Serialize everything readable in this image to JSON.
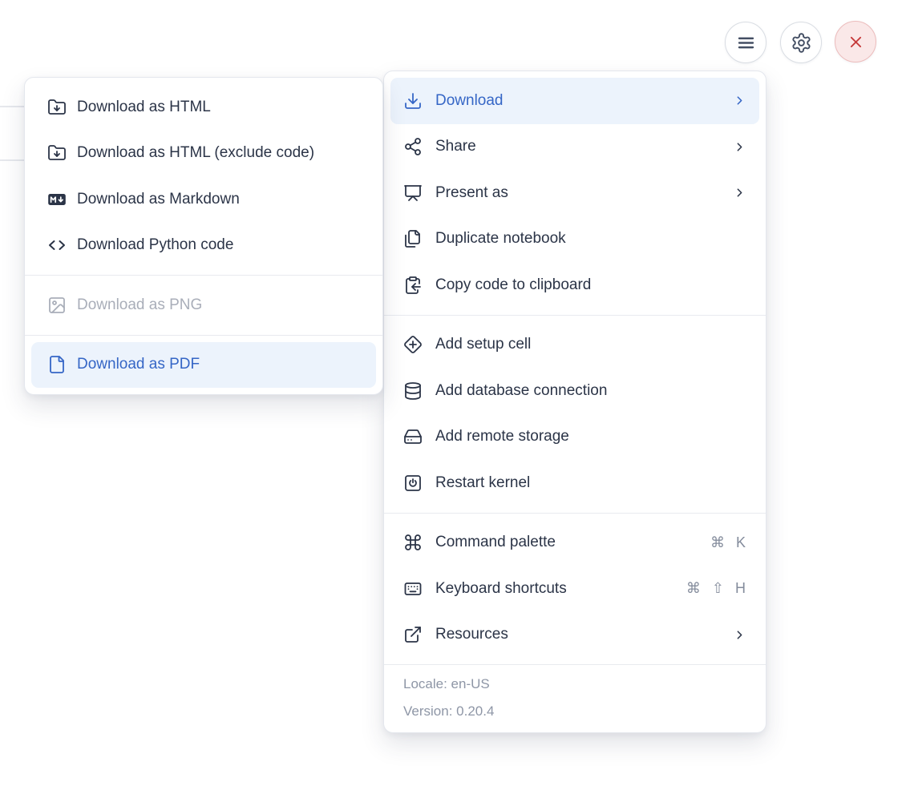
{
  "topbar": {
    "buttons": [
      {
        "name": "menu-button",
        "icon": "menu-icon"
      },
      {
        "name": "settings-button",
        "icon": "settings-gear-icon"
      },
      {
        "name": "close-button",
        "icon": "close-icon"
      }
    ]
  },
  "submenu": {
    "sections": [
      {
        "items": [
          {
            "label": "Download as HTML",
            "icon": "folder-download-icon"
          },
          {
            "label": "Download as HTML (exclude code)",
            "icon": "folder-download-icon"
          },
          {
            "label": "Download as Markdown",
            "icon": "markdown-download-icon"
          },
          {
            "label": "Download Python code",
            "icon": "code-icon"
          }
        ]
      },
      {
        "items": [
          {
            "label": "Download as PNG",
            "icon": "image-icon",
            "disabled": true
          }
        ]
      },
      {
        "items": [
          {
            "label": "Download as PDF",
            "icon": "file-icon",
            "highlighted": true
          }
        ]
      }
    ]
  },
  "menu": {
    "sections": [
      {
        "items": [
          {
            "label": "Download",
            "icon": "download-icon",
            "highlighted": true,
            "submenu": true
          },
          {
            "label": "Share",
            "icon": "share-icon",
            "submenu": true
          },
          {
            "label": "Present as",
            "icon": "presentation-icon",
            "submenu": true
          },
          {
            "label": "Duplicate notebook",
            "icon": "duplicate-icon"
          },
          {
            "label": "Copy code to clipboard",
            "icon": "clipboard-copy-icon"
          }
        ]
      },
      {
        "items": [
          {
            "label": "Add setup cell",
            "icon": "diamond-plus-icon"
          },
          {
            "label": "Add database connection",
            "icon": "database-icon"
          },
          {
            "label": "Add remote storage",
            "icon": "hard-drive-icon"
          },
          {
            "label": "Restart kernel",
            "icon": "power-icon"
          }
        ]
      },
      {
        "items": [
          {
            "label": "Command palette",
            "icon": "command-icon",
            "shortcut": "⌘ K"
          },
          {
            "label": "Keyboard shortcuts",
            "icon": "keyboard-icon",
            "shortcut": "⌘ ⇧ H"
          },
          {
            "label": "Resources",
            "icon": "external-link-icon",
            "submenu": true
          }
        ]
      }
    ],
    "footer": {
      "locale": "Locale: en-US",
      "version": "Version: 0.20.4"
    }
  },
  "colors": {
    "accent": "#3566c6",
    "accent_background": "#ecf3fc",
    "text": "#2b3447",
    "disabled_text": "#a9aeb9",
    "shortcut_text": "#848c9c",
    "footer_text": "#8e96a6",
    "danger": "#c53a3a",
    "danger_background": "#fae8e8"
  }
}
